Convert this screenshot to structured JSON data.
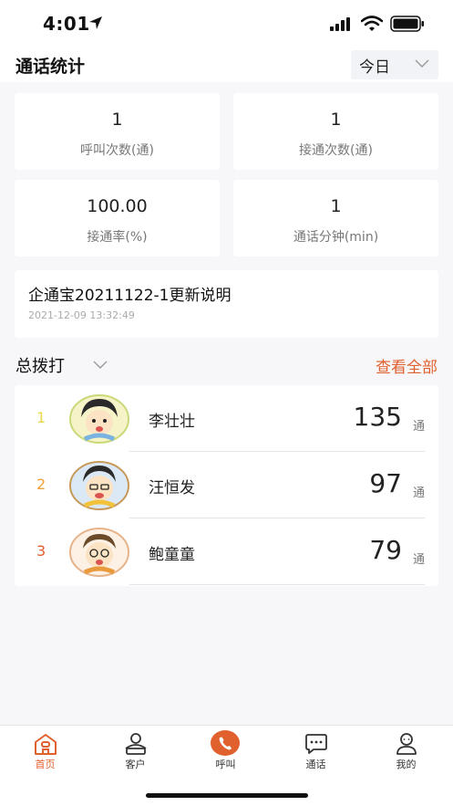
{
  "status_bar": {
    "time": "4:01"
  },
  "header": {
    "title": "通话统计",
    "date_filter": "今日"
  },
  "stats": [
    {
      "value": "1",
      "label": "呼叫次数(通)"
    },
    {
      "value": "1",
      "label": "接通次数(通)"
    },
    {
      "value": "100.00",
      "label": "接通率(%)"
    },
    {
      "value": "1",
      "label": "通话分钟(min)"
    }
  ],
  "notice": {
    "title": "企通宝20211122-1更新说明",
    "time": "2021-12-09 13:32:49"
  },
  "ranking": {
    "filter_label": "总拨打",
    "view_all": "查看全部",
    "unit": "通",
    "rank_colors": [
      "#e8d94a",
      "#f0a13c",
      "#e0602e"
    ],
    "items": [
      {
        "rank": "1",
        "name": "李壮壮",
        "count": "135"
      },
      {
        "rank": "2",
        "name": "汪恒发",
        "count": "97"
      },
      {
        "rank": "3",
        "name": "鲍童童",
        "count": "79"
      }
    ]
  },
  "tabbar": {
    "active_color": "#e0602e",
    "items": [
      {
        "label": "首页",
        "icon": "home-icon",
        "active": true
      },
      {
        "label": "客户",
        "icon": "customer-icon",
        "active": false
      },
      {
        "label": "呼叫",
        "icon": "phone-call-icon",
        "active": false
      },
      {
        "label": "通话",
        "icon": "chat-icon",
        "active": false
      },
      {
        "label": "我的",
        "icon": "profile-icon",
        "active": false
      }
    ]
  }
}
